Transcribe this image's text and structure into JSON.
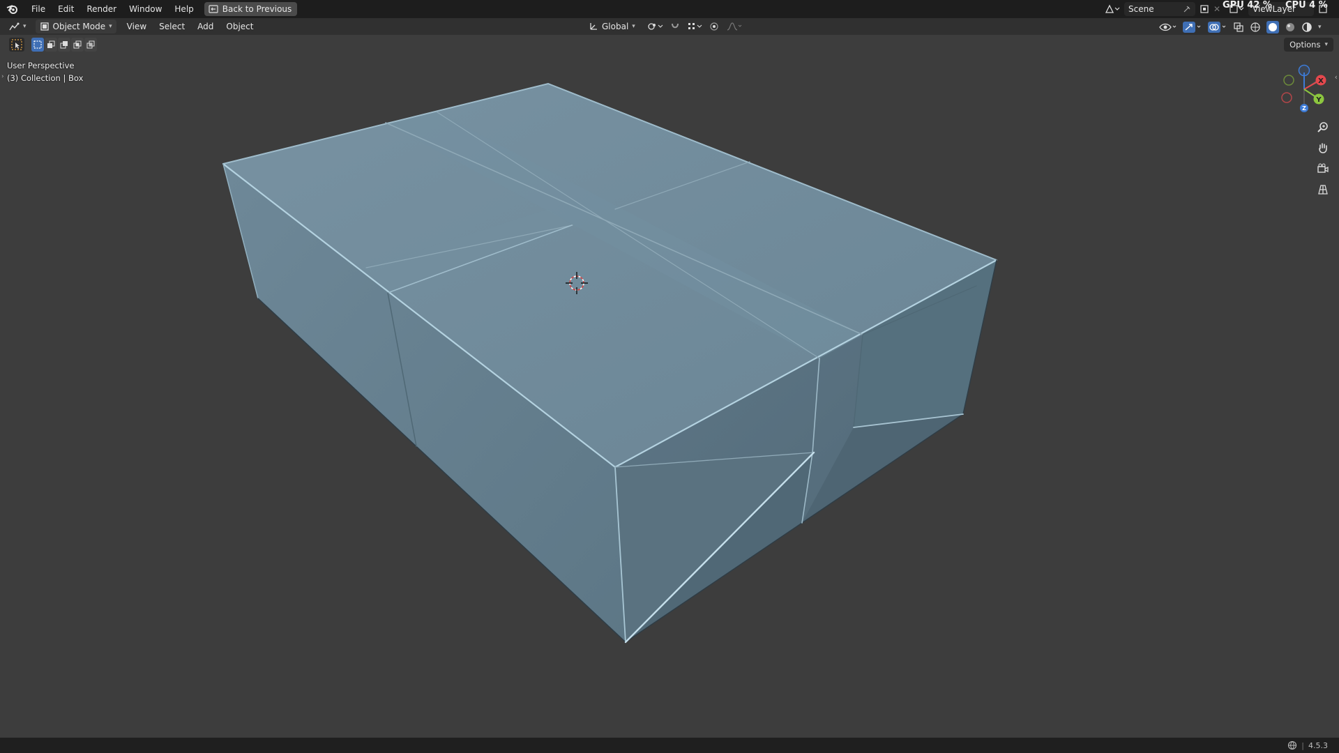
{
  "menu": {
    "items": [
      "File",
      "Edit",
      "Render",
      "Window",
      "Help"
    ],
    "back_button": "Back to Previous"
  },
  "scene": {
    "label": "Scene"
  },
  "viewlayer": {
    "label": "ViewLayer"
  },
  "stats": {
    "gpu": "GPU 42 %",
    "cpu": "CPU 4 %"
  },
  "viewport_header": {
    "mode": "Object Mode",
    "view": "View",
    "select": "Select",
    "add": "Add",
    "object": "Object",
    "orientation": "Global"
  },
  "overlay": {
    "perspective": "User Perspective",
    "collection": "(3) Collection | Box"
  },
  "options": {
    "label": "Options"
  },
  "gizmo": {
    "x": "X",
    "y": "Y",
    "z": "Z"
  },
  "status": {
    "version": "4.5.3"
  },
  "colors": {
    "axis_x": "#e5484d",
    "axis_y": "#8cc63f",
    "axis_z": "#3d7bd6",
    "mesh": "#6d8797"
  }
}
